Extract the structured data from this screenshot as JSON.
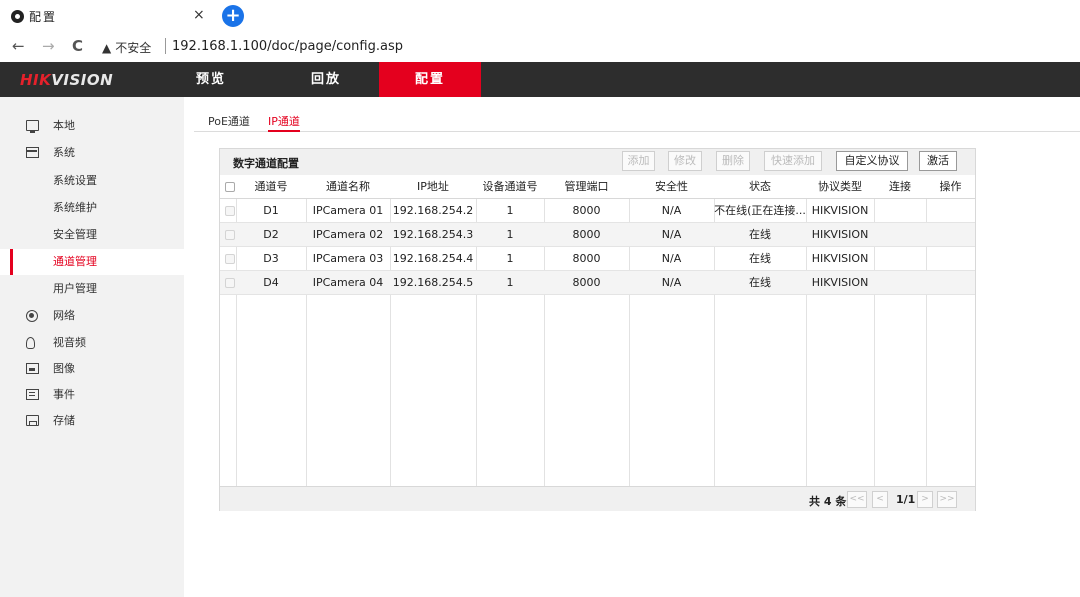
{
  "browser": {
    "tab_title": "配置",
    "tab_close": "×",
    "new_tab": "+",
    "back": "←",
    "forward": "→",
    "reload": "C",
    "warning_icon": "▲",
    "warning_text": "不安全",
    "url": "192.168.1.100/doc/page/config.asp"
  },
  "header": {
    "logo_hik": "HIK",
    "logo_vision": "VISION",
    "nav": [
      {
        "label": "预览"
      },
      {
        "label": "回放"
      },
      {
        "label": "配置",
        "active": true
      }
    ],
    "accent_color": "#e4001e"
  },
  "sidebar": {
    "items": [
      {
        "label": "本地",
        "icon": "monitor-icon"
      },
      {
        "label": "系统",
        "icon": "window-icon"
      },
      {
        "label": "系统设置"
      },
      {
        "label": "系统维护"
      },
      {
        "label": "安全管理"
      },
      {
        "label": "通道管理",
        "active": true
      },
      {
        "label": "用户管理"
      },
      {
        "label": "网络",
        "icon": "globe-icon"
      },
      {
        "label": "视音频",
        "icon": "audio-video-icon"
      },
      {
        "label": "图像",
        "icon": "image-icon"
      },
      {
        "label": "事件",
        "icon": "event-icon"
      },
      {
        "label": "存储",
        "icon": "storage-icon"
      }
    ]
  },
  "subtabs": [
    {
      "label": "PoE通道"
    },
    {
      "label": "IP通道",
      "active": true
    }
  ],
  "panel": {
    "title": "数字通道配置",
    "buttons": {
      "add": "添加",
      "modify": "修改",
      "delete": "删除",
      "quick_add": "快速添加",
      "custom_protocol": "自定义协议",
      "activate": "激活"
    },
    "columns": [
      "通道号",
      "通道名称",
      "IP地址",
      "设备通道号",
      "管理端口",
      "安全性",
      "状态",
      "协议类型",
      "连接",
      "操作"
    ],
    "rows": [
      {
        "channel": "D1",
        "name": "IPCamera 01",
        "ip": "192.168.254.2",
        "dev_channel": "1",
        "port": "8000",
        "security": "N/A",
        "status": "不在线(正在连接...",
        "protocol": "HIKVISION",
        "connect": "",
        "action": ""
      },
      {
        "channel": "D2",
        "name": "IPCamera 02",
        "ip": "192.168.254.3",
        "dev_channel": "1",
        "port": "8000",
        "security": "N/A",
        "status": "在线",
        "protocol": "HIKVISION",
        "connect": "",
        "action": ""
      },
      {
        "channel": "D3",
        "name": "IPCamera 03",
        "ip": "192.168.254.4",
        "dev_channel": "1",
        "port": "8000",
        "security": "N/A",
        "status": "在线",
        "protocol": "HIKVISION",
        "connect": "",
        "action": ""
      },
      {
        "channel": "D4",
        "name": "IPCamera 04",
        "ip": "192.168.254.5",
        "dev_channel": "1",
        "port": "8000",
        "security": "N/A",
        "status": "在线",
        "protocol": "HIKVISION",
        "connect": "",
        "action": ""
      }
    ],
    "footer": {
      "total": "共 4 条",
      "first": "<<",
      "prev": "<",
      "page": "1/1",
      "next": ">",
      "last": ">>"
    }
  }
}
